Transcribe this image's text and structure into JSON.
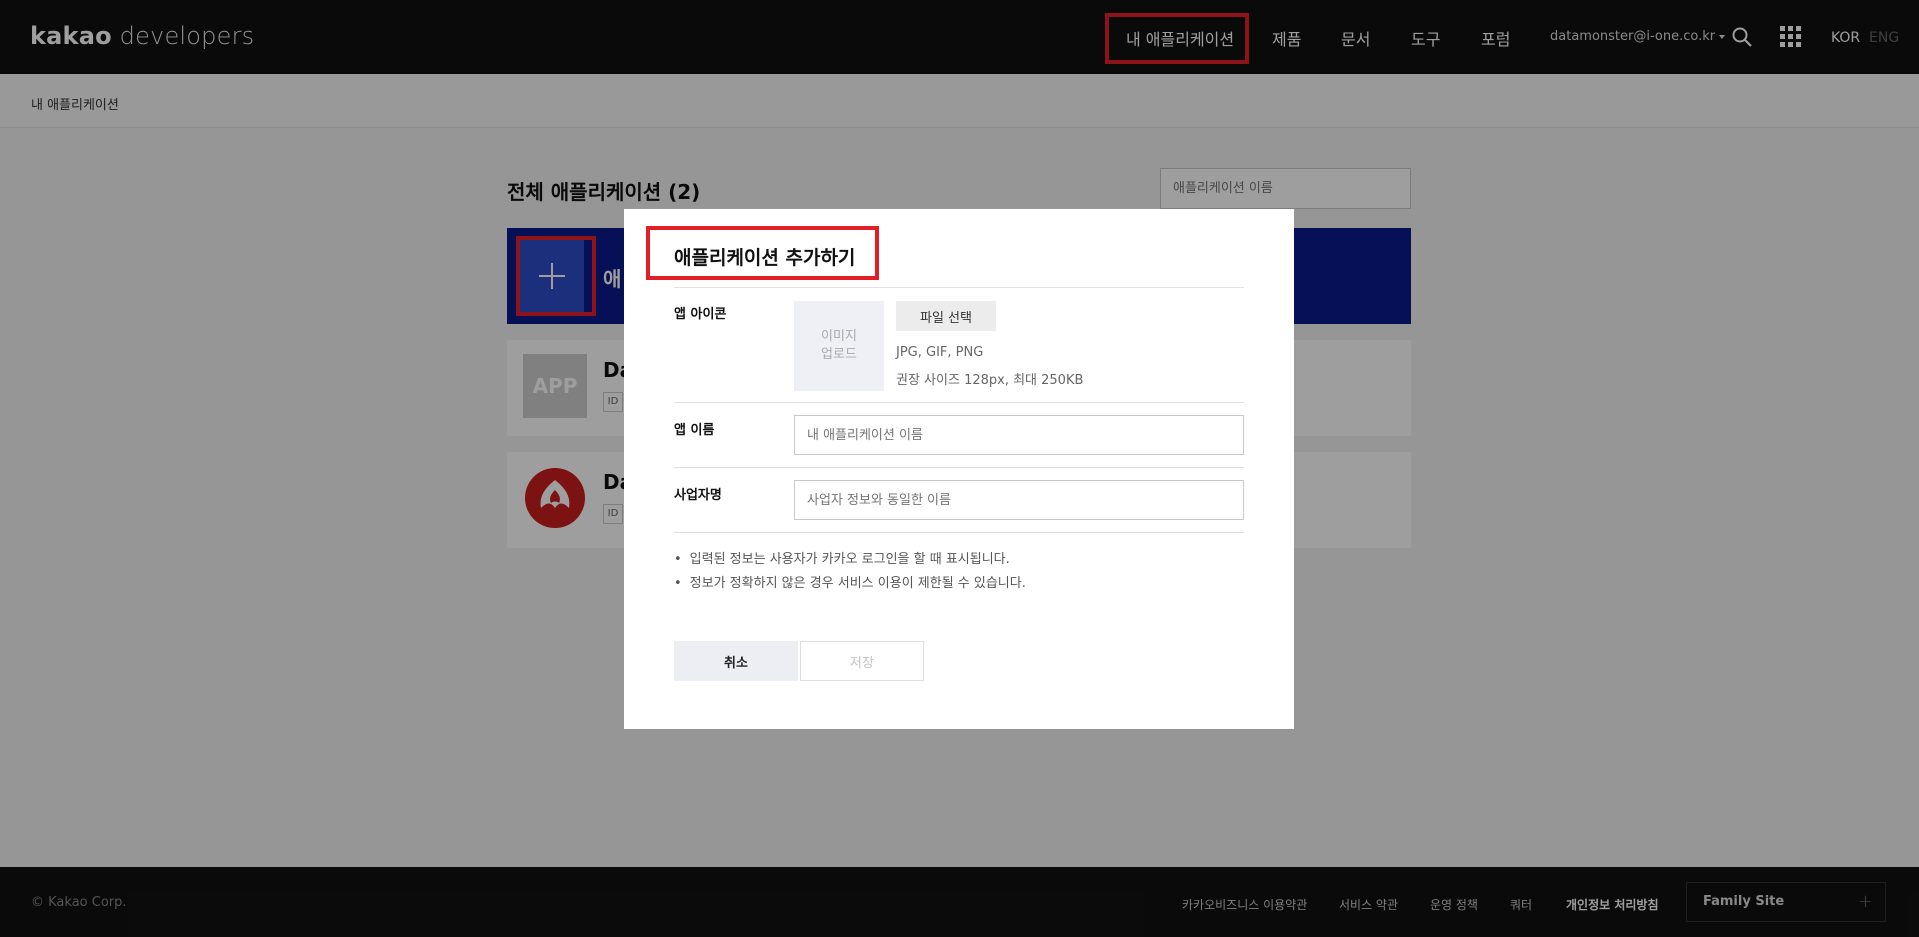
{
  "header": {
    "logo_bold": "kakao",
    "logo_light": "developers",
    "nav": [
      "내 애플리케이션",
      "제품",
      "문서",
      "도구",
      "포럼"
    ],
    "user_email": "datamonster@i-one.co.kr",
    "lang_active": "KOR",
    "lang_inactive": "ENG",
    "icons": {
      "search": "search-icon",
      "apps": "grid-icon"
    }
  },
  "breadcrumb": "내 애플리케이션",
  "main": {
    "title": "전체 애플리케이션 (2)",
    "search_placeholder": "애플리케이션 이름",
    "add_label": "애",
    "apps": [
      {
        "thumb": "APP",
        "name": "Da",
        "id_tag": "ID"
      },
      {
        "thumb": "",
        "name": "Da",
        "id_tag": "ID"
      }
    ]
  },
  "modal": {
    "title": "애플리케이션 추가하기",
    "icon_label": "앱 아이콘",
    "upload_line1": "이미지",
    "upload_line2": "업로드",
    "file_button": "파일 선택",
    "hint_formats": "JPG, GIF, PNG",
    "hint_size": "권장 사이즈 128px, 최대 250KB",
    "name_label": "앱 이름",
    "name_placeholder": "내 애플리케이션 이름",
    "company_label": "사업자명",
    "company_placeholder": "사업자 정보와 동일한 이름",
    "notes": [
      "입력된 정보는 사용자가 카카오 로그인을 할 때 표시됩니다.",
      "정보가 정확하지 않은 경우 서비스 이용이 제한될 수 있습니다."
    ],
    "cancel": "취소",
    "save": "저장"
  },
  "footer": {
    "copyright": "© Kakao Corp.",
    "links": [
      "카카오비즈니스 이용약관",
      "서비스 약관",
      "운영 정책",
      "쿼터",
      "개인정보 처리방침"
    ],
    "family_site": "Family Site",
    "family_plus": "+"
  },
  "colors": {
    "header_bg": "#111111",
    "add_card": "#0a1a8c",
    "highlight": "#e21f26"
  }
}
